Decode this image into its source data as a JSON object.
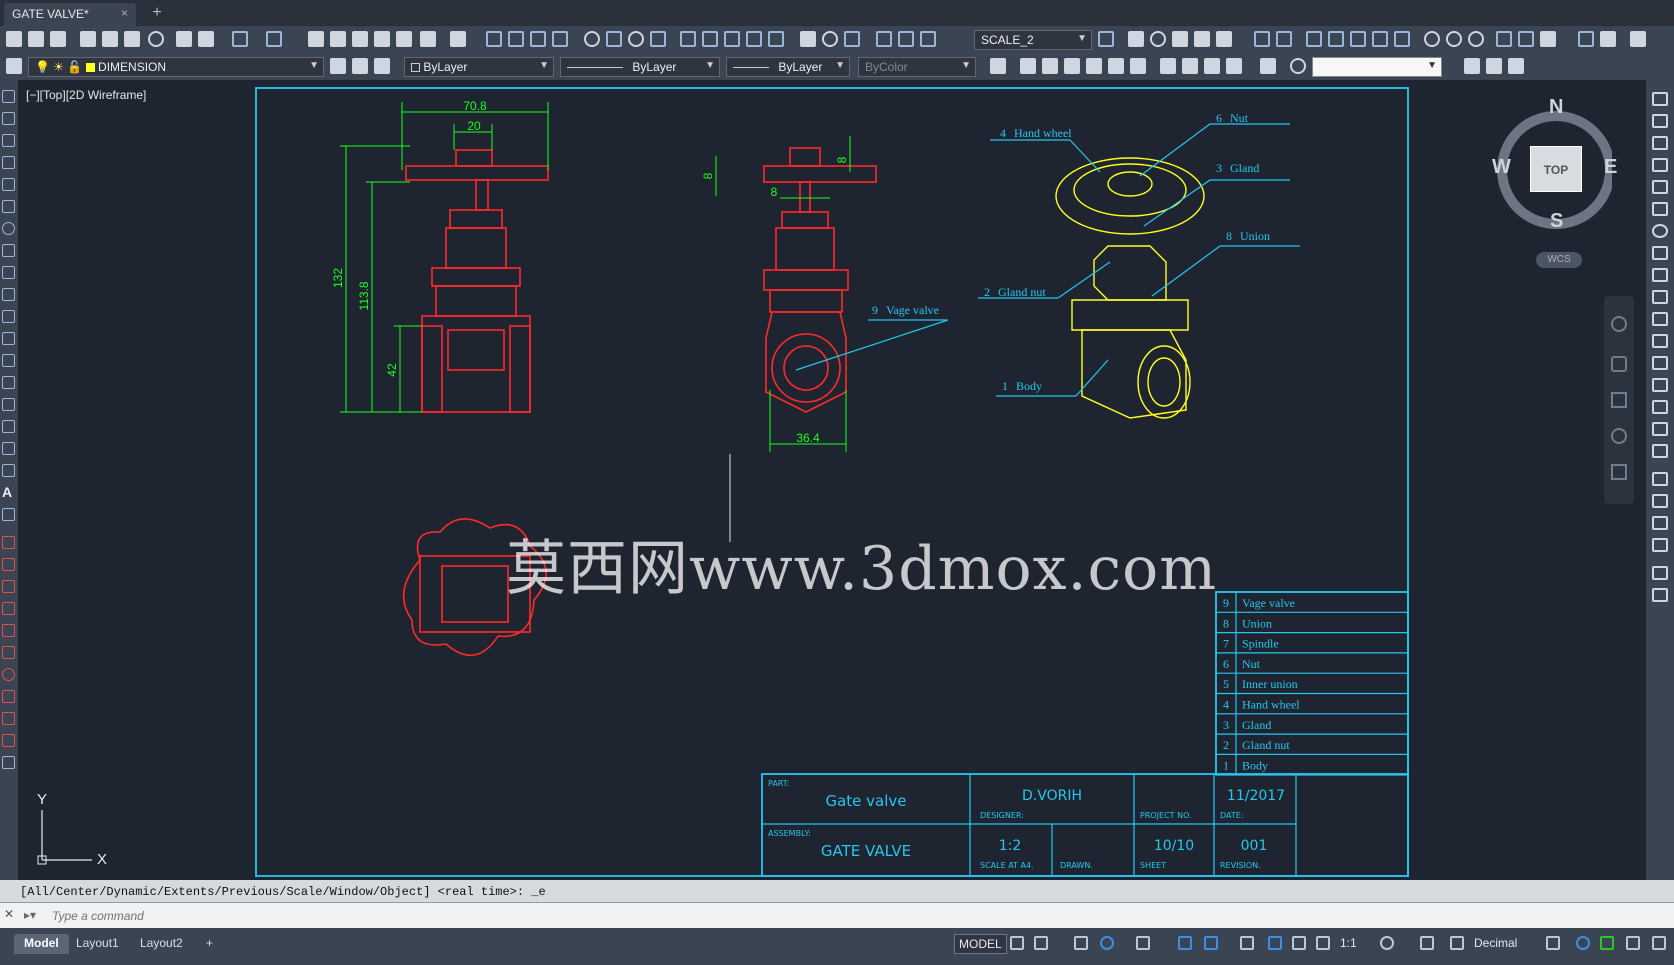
{
  "app": {
    "doc_tab": "GATE VALVE*",
    "close_symbol": "×",
    "new_tab_symbol": "+"
  },
  "toolbar": {
    "scale_value": "SCALE_2",
    "layer_name": "DIMENSION",
    "color": "ByLayer",
    "linetype": "ByLayer",
    "lineweight": "ByLayer",
    "plotstyle": "ByColor"
  },
  "viewport": {
    "label": "[−][Top][2D Wireframe]"
  },
  "watermark": "莫西网www.3dmox.com",
  "drawing": {
    "front_dims": [
      "70.8",
      "20",
      "132",
      "113.8",
      "42"
    ],
    "side_dims": [
      "8",
      "8",
      "8",
      "36.4"
    ],
    "callouts": [
      {
        "num": "4",
        "label": "Hand wheel"
      },
      {
        "num": "6",
        "label": "Nut"
      },
      {
        "num": "3",
        "label": "Gland"
      },
      {
        "num": "8",
        "label": "Union"
      },
      {
        "num": "2",
        "label": "Gland nut"
      },
      {
        "num": "1",
        "label": "Body"
      },
      {
        "num": "9",
        "label": "Vage valve"
      }
    ],
    "parts_list": [
      {
        "num": "9",
        "name": "Vage valve"
      },
      {
        "num": "8",
        "name": "Union"
      },
      {
        "num": "7",
        "name": "Spindle"
      },
      {
        "num": "6",
        "name": "Nut"
      },
      {
        "num": "5",
        "name": "Inner union"
      },
      {
        "num": "4",
        "name": "Hand wheel"
      },
      {
        "num": "3",
        "name": "Gland"
      },
      {
        "num": "2",
        "name": "Gland nut"
      },
      {
        "num": "1",
        "name": "Body"
      }
    ],
    "title_block": {
      "part_caption": "PART:",
      "part": "Gate valve",
      "assembly_caption": "ASSEMBLY:",
      "assembly": "GATE VALVE",
      "designer": "D.VORIH",
      "designer_caption": "DESIGNER:",
      "project_caption": "PROJECT NO.",
      "date": "11/2017",
      "date_caption": "DATE:",
      "scale": "1:2",
      "scale_caption": "SCALE AT A4.",
      "drawn_caption": "DRAWN.",
      "sheet": "10/10",
      "sheet_caption": "SHEET",
      "revision": "001",
      "revision_caption": "REVISION."
    }
  },
  "viewcube": {
    "top": "TOP",
    "n": "N",
    "s": "S",
    "e": "E",
    "w": "W",
    "wcs": "WCS"
  },
  "ucs": {
    "x": "X",
    "y": "Y"
  },
  "command": {
    "history": "[All/Center/Dynamic/Extents/Previous/Scale/Window/Object] <real time>: _e",
    "placeholder": "Type a command"
  },
  "status": {
    "tabs": [
      "Model",
      "Layout1",
      "Layout2"
    ],
    "add_tab": "+",
    "model": "MODEL",
    "annoscale": "1:1",
    "units": "Decimal"
  },
  "colors": {
    "red": "#ff2a2a",
    "green": "#18ff18",
    "cyan": "#26c6f0",
    "yellow": "#ffff20",
    "bg": "#1e2530"
  }
}
